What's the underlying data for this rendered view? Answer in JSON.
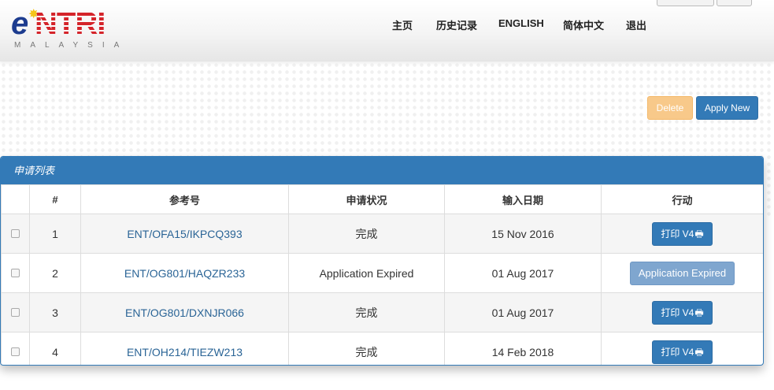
{
  "logo": {
    "brand_e": "e",
    "brand_ntri": "NTRI",
    "subtitle": "MALAYSIA"
  },
  "nav": {
    "home": "主页",
    "history": "历史记录",
    "english": "ENGLISH",
    "chinese": "简体中文",
    "logout": "退出"
  },
  "actions": {
    "delete": "Delete",
    "apply_new": "Apply New"
  },
  "panel": {
    "title": "申请列表"
  },
  "table": {
    "headers": [
      "",
      "#",
      "参考号",
      "申请状况",
      "输入日期",
      "行动"
    ],
    "rows": [
      {
        "num": "1",
        "ref": "ENT/OFA15/IKPCQ393",
        "status": "完成",
        "date": "15 Nov 2016",
        "action": "打印 V4"
      },
      {
        "num": "2",
        "ref": "ENT/OG801/HAQZR233",
        "status": "Application Expired",
        "date": "01 Aug 2017",
        "action": "Application Expired"
      },
      {
        "num": "3",
        "ref": "ENT/OG801/DXNJR066",
        "status": "完成",
        "date": "01 Aug 2017",
        "action": "打印 V4"
      },
      {
        "num": "4",
        "ref": "ENT/OH214/TIEZW213",
        "status": "完成",
        "date": "14 Feb 2018",
        "action": "打印 V4"
      }
    ]
  },
  "icons": {
    "print": "printer-icon",
    "star": "star-icon"
  },
  "colors": {
    "primary": "#337ab7",
    "warning": "#f8c98a",
    "link": "#2a6496"
  }
}
